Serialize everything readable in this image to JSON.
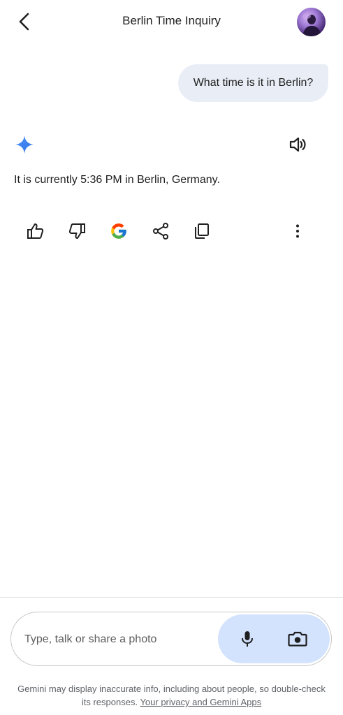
{
  "header": {
    "title": "Berlin Time Inquiry"
  },
  "conversation": {
    "user_message": "What time is it in Berlin?",
    "response_text": "It is currently 5:36 PM in Berlin, Germany."
  },
  "icons": {
    "back": "back-arrow-icon",
    "avatar": "user-avatar",
    "spark": "gemini-spark-icon",
    "speaker": "speaker-icon",
    "actions": [
      "thumbs-up-icon",
      "thumbs-down-icon",
      "google-icon",
      "share-icon",
      "copy-icon",
      "more-vert-icon"
    ],
    "mic": "mic-icon",
    "camera": "camera-icon"
  },
  "composer": {
    "placeholder": "Type, talk or share a photo"
  },
  "footer": {
    "disclaimer": "Gemini may display inaccurate info, including about people, so double-check its responses.",
    "privacy_link": "Your privacy and Gemini Apps"
  },
  "colors": {
    "accent_bubble": "#e9eef6",
    "composer_actions_bg": "#d3e3fd",
    "spark_blue": "#4285f4"
  }
}
